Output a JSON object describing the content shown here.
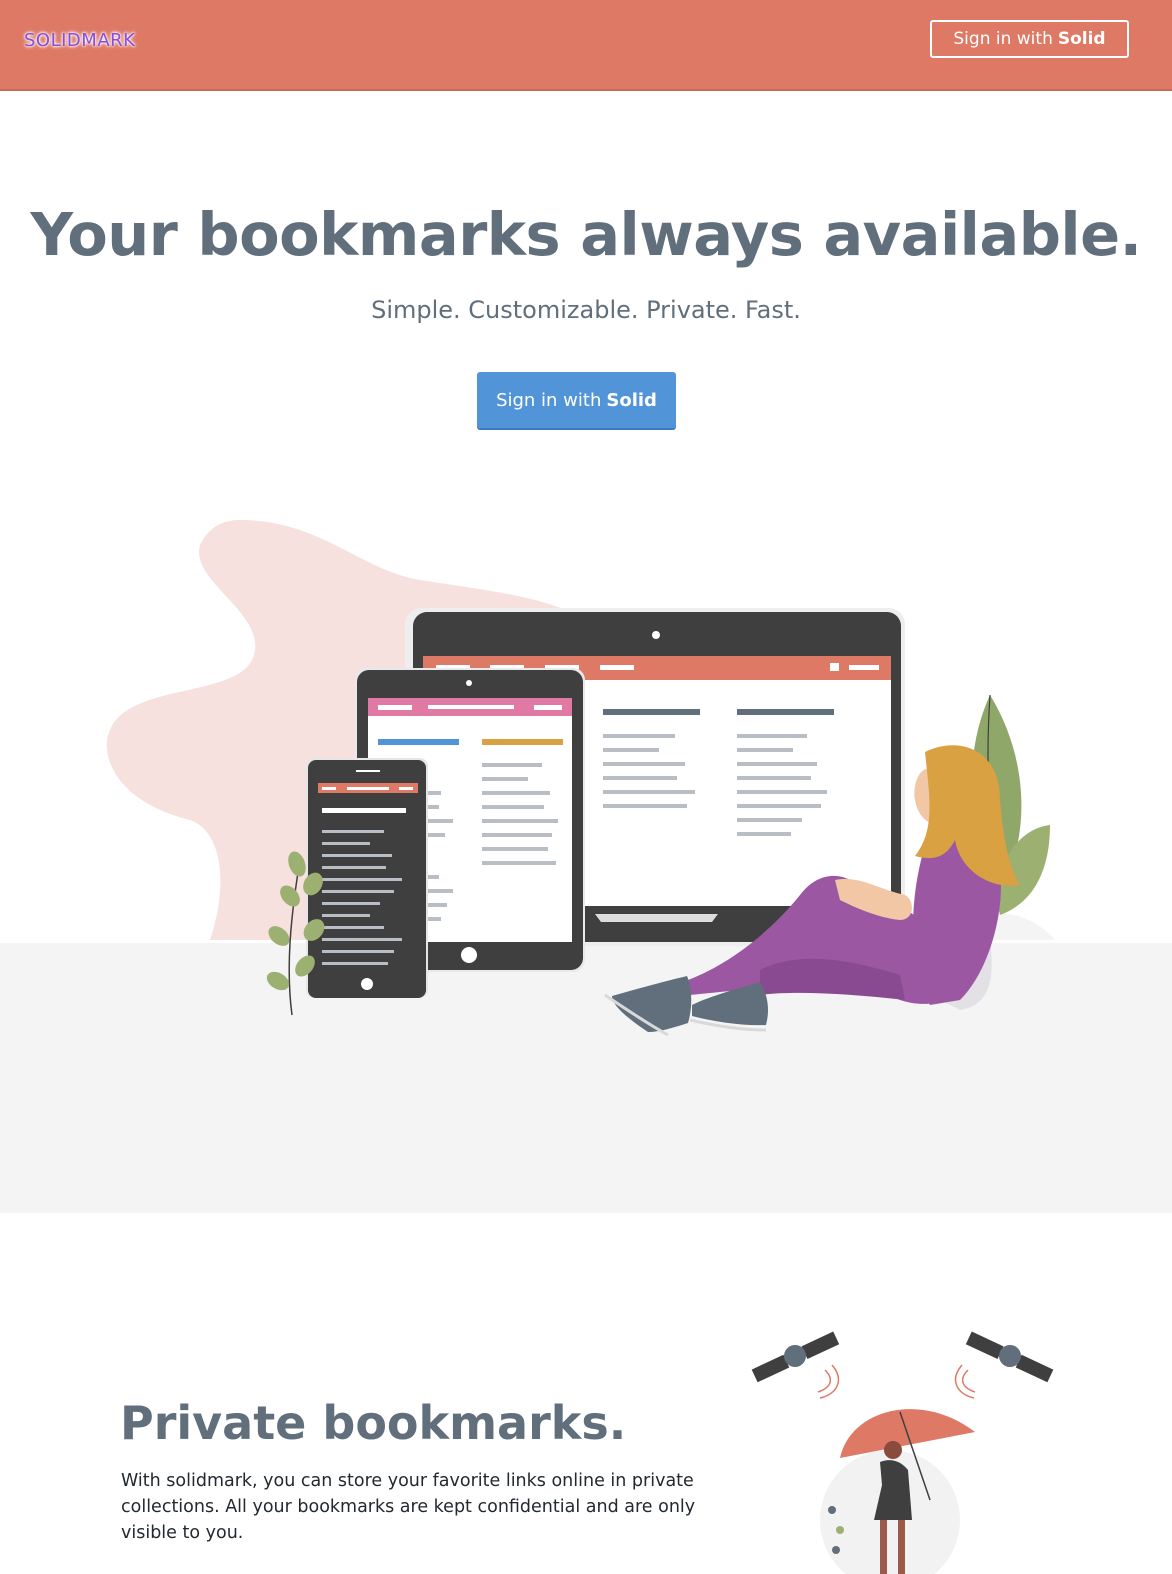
{
  "header": {
    "logo": "SOLIDMARK",
    "signin_prefix": "Sign in with",
    "signin_emphasis": "Solid"
  },
  "hero": {
    "title": "Your bookmarks always available.",
    "subtitle": "Simple. Customizable. Private. Fast.",
    "cta_prefix": "Sign in with",
    "cta_emphasis": "Solid"
  },
  "feature": {
    "title": "Private bookmarks.",
    "text": "With solidmark, you can store your favorite links online in private collections. All your bookmarks are kept confidential and are only visible to you."
  },
  "colors": {
    "header": "#de7966",
    "primary": "#5294d8",
    "heading": "#606f7b",
    "band": "#f4f4f4"
  }
}
